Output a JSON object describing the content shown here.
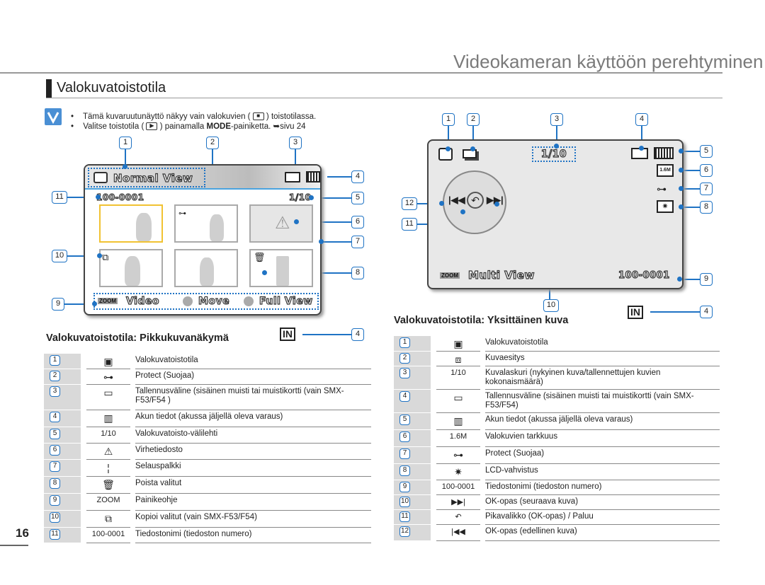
{
  "header": {
    "title": "Videokameran käyttöön perehtyminen"
  },
  "section": {
    "title": "Valokuvatoistotila"
  },
  "notes": [
    {
      "text_before": "Tämä kuvaruutunäyttö näkyy vain valokuvien (",
      "icon": "photo-playback-icon",
      "text_after": ") toistotilassa."
    },
    {
      "text_before": "Valitse toistotila (",
      "icon": "play-icon",
      "text_mid": ") painamalla ",
      "bold": "MODE",
      "text_after": "-painiketta. ",
      "ref": "➥sivu 24"
    }
  ],
  "thumbnail_screen": {
    "caption": "Valokuvatoistotila: Pikkukuvanäkymä",
    "mode_label": "Normal View",
    "file_name": "100-0001",
    "counter": "1/10",
    "guide": {
      "zoom": "ZOOM",
      "video": "Video",
      "move": "Move",
      "full_view": "Full View"
    },
    "in_icon": "IN",
    "callouts": [
      "1",
      "2",
      "3",
      "4",
      "5",
      "6",
      "7",
      "8",
      "9",
      "10",
      "11"
    ],
    "in_callout": "4"
  },
  "single_screen": {
    "caption": "Valokuvatoistotila: Yksittäinen kuva",
    "counter": "1/10",
    "resolution": "1.6M",
    "zoom": "ZOOM",
    "mode_label": "Multi View",
    "file_name": "100-0001",
    "in_icon": "IN",
    "callouts": [
      "1",
      "2",
      "3",
      "4",
      "5",
      "6",
      "7",
      "8",
      "9",
      "10",
      "11",
      "12"
    ],
    "in_callout": "4"
  },
  "left_table": [
    {
      "num": "1",
      "icon": "photo-playback-icon",
      "icon_text": "",
      "desc": "Valokuvatoistotila"
    },
    {
      "num": "2",
      "icon": "protect-key-icon",
      "icon_text": "",
      "desc": "Protect (Suojaa)"
    },
    {
      "num": "3",
      "icon": "storage-card-icon",
      "icon_text": "",
      "desc": "Tallennusväline (sisäinen muisti tai muistikortti (vain SMX-F53/F54 )"
    },
    {
      "num": "4",
      "icon": "battery-icon",
      "icon_text": "",
      "desc": "Akun tiedot (akussa jäljellä oleva varaus)"
    },
    {
      "num": "5",
      "icon": "counter-icon",
      "icon_text": "1/10",
      "desc": "Valokuvatoisto-välilehti"
    },
    {
      "num": "6",
      "icon": "error-file-icon",
      "icon_text": "",
      "desc": "Virhetiedosto"
    },
    {
      "num": "7",
      "icon": "scroll-bar-icon",
      "icon_text": "",
      "desc": "Selauspalkki"
    },
    {
      "num": "8",
      "icon": "trash-icon",
      "icon_text": "",
      "desc": "Poista valitut"
    },
    {
      "num": "9",
      "icon": "button-guide-icon",
      "icon_text": "ZOOM",
      "desc": "Painikeohje"
    },
    {
      "num": "10",
      "icon": "copy-icon",
      "icon_text": "",
      "desc": "Kopioi valitut (vain SMX-F53/F54)"
    },
    {
      "num": "11",
      "icon": "file-name-icon",
      "icon_text": "100-0001",
      "desc": "Tiedostonimi (tiedoston numero)"
    }
  ],
  "right_table": [
    {
      "num": "1",
      "icon": "photo-playback-icon",
      "icon_text": "",
      "desc": "Valokuvatoistotila"
    },
    {
      "num": "2",
      "icon": "slideshow-icon",
      "icon_text": "",
      "desc": "Kuvaesitys"
    },
    {
      "num": "3",
      "icon": "counter-icon",
      "icon_text": "1/10",
      "desc": "Kuvalaskuri (nykyinen kuva/tallennettujen kuvien kokonaismäärä)"
    },
    {
      "num": "4",
      "icon": "storage-card-icon",
      "icon_text": "",
      "desc": "Tallennusväline (sisäinen muisti tai muistikortti (vain SMX-F53/F54)"
    },
    {
      "num": "5",
      "icon": "battery-icon",
      "icon_text": "",
      "desc": "Akun tiedot (akussa jäljellä oleva varaus)"
    },
    {
      "num": "6",
      "icon": "resolution-icon",
      "icon_text": "1.6M",
      "desc": "Valokuvien tarkkuus"
    },
    {
      "num": "7",
      "icon": "protect-key-icon",
      "icon_text": "",
      "desc": "Protect (Suojaa)"
    },
    {
      "num": "8",
      "icon": "lcd-enhancer-icon",
      "icon_text": "",
      "desc": "LCD-vahvistus"
    },
    {
      "num": "9",
      "icon": "file-name-icon",
      "icon_text": "100-0001",
      "desc": "Tiedostonimi (tiedoston numero)"
    },
    {
      "num": "10",
      "icon": "next-icon",
      "icon_text": "▶▶|",
      "desc": "OK-opas (seuraava kuva)"
    },
    {
      "num": "11",
      "icon": "return-icon",
      "icon_text": "↶",
      "desc": "Pikavalikko (OK-opas) / Paluu"
    },
    {
      "num": "12",
      "icon": "previous-icon",
      "icon_text": "|◀◀",
      "desc": "OK-opas (edellinen kuva)"
    }
  ],
  "colors": {
    "callout_blue": "#1f73c4",
    "selection_yellow": "#f1c232",
    "note_blue": "#4a8fd4"
  },
  "page": {
    "number": "16"
  }
}
